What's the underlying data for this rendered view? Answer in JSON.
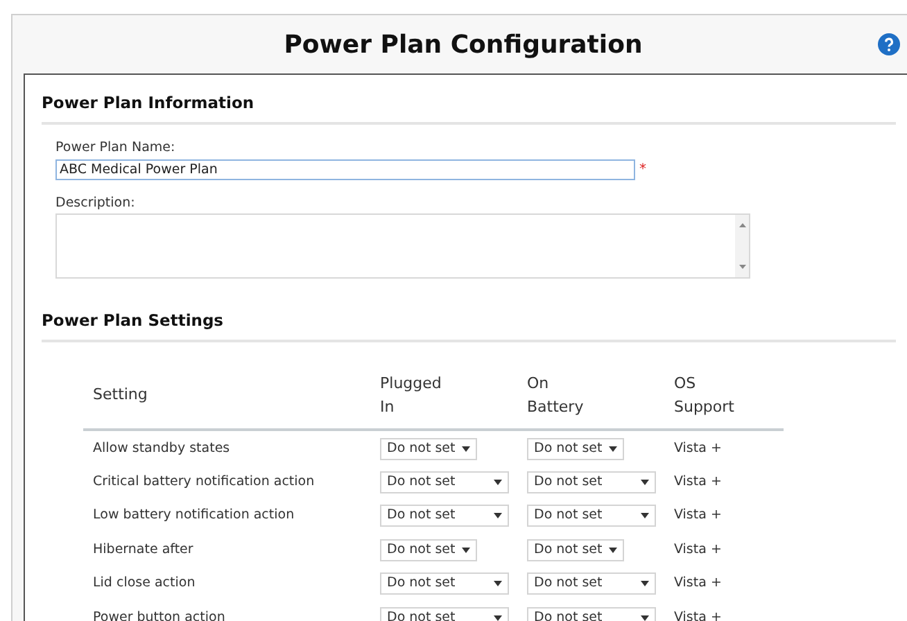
{
  "title": "Power Plan Configuration",
  "info": {
    "heading": "Power Plan Information",
    "name_label": "Power Plan Name:",
    "name_value": "ABC Medical Power Plan",
    "required_mark": "*",
    "description_label": "Description:"
  },
  "settings": {
    "heading": "Power Plan Settings",
    "columns": [
      "Setting",
      "Plugged In",
      "On Battery",
      "OS Support"
    ],
    "rows": [
      {
        "setting": "Allow standby states",
        "plugged_in": {
          "value": "Do not set",
          "kind": "compact"
        },
        "on_battery": {
          "value": "Do not set",
          "kind": "compact"
        },
        "os_support": "Vista +"
      },
      {
        "setting": "Critical battery notification action",
        "plugged_in": {
          "value": "Do not set",
          "kind": "wide"
        },
        "on_battery": {
          "value": "Do not set",
          "kind": "wide"
        },
        "os_support": "Vista +"
      },
      {
        "setting": "Low battery notification action",
        "plugged_in": {
          "value": "Do not set",
          "kind": "wide"
        },
        "on_battery": {
          "value": "Do not set",
          "kind": "wide"
        },
        "os_support": "Vista +"
      },
      {
        "setting": "Hibernate after",
        "plugged_in": {
          "value": "Do not set",
          "kind": "compact"
        },
        "on_battery": {
          "value": "Do not set",
          "kind": "compact"
        },
        "os_support": "Vista +"
      },
      {
        "setting": "Lid close action",
        "plugged_in": {
          "value": "Do not set",
          "kind": "wide"
        },
        "on_battery": {
          "value": "Do not set",
          "kind": "wide"
        },
        "os_support": "Vista +"
      },
      {
        "setting": "Power button action",
        "plugged_in": {
          "value": "Do not set",
          "kind": "wide"
        },
        "on_battery": {
          "value": "Do not set",
          "kind": "wide"
        },
        "os_support": "Vista +"
      }
    ]
  }
}
